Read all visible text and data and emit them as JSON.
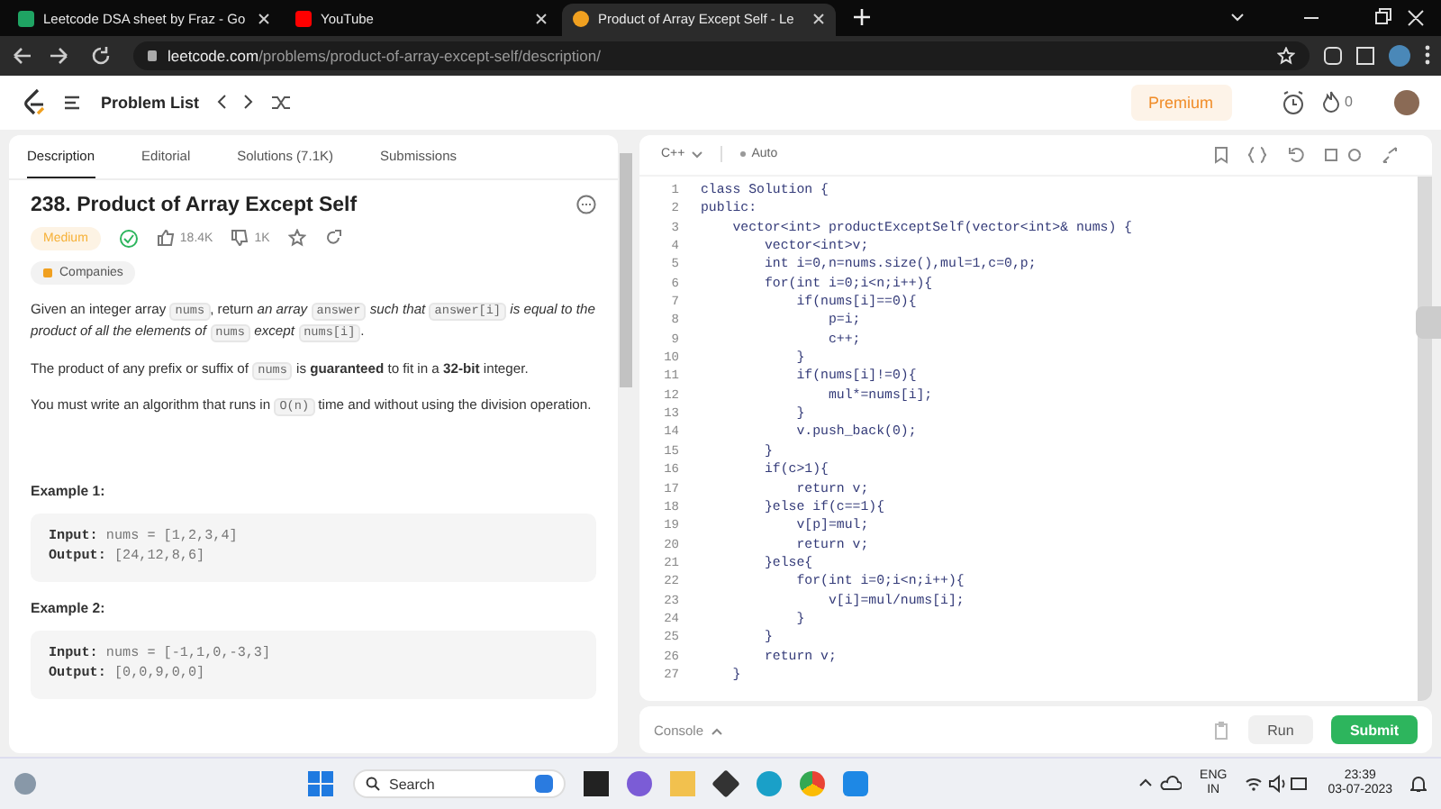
{
  "browser": {
    "tabs": [
      {
        "title": "Leetcode DSA sheet by Fraz - Go",
        "selected": false
      },
      {
        "title": "YouTube",
        "selected": false
      },
      {
        "title": "Product of Array Except Self - Le",
        "selected": true
      }
    ],
    "url_host": "leetcode.com",
    "url_path": "/problems/product-of-array-except-self/description/"
  },
  "header": {
    "problem_list": "Problem List",
    "premium": "Premium",
    "streak": "0"
  },
  "left_tabs": [
    {
      "label": "Description",
      "selected": true
    },
    {
      "label": "Editorial",
      "selected": false
    },
    {
      "label": "Solutions (7.1K)",
      "selected": false
    },
    {
      "label": "Submissions",
      "selected": false
    }
  ],
  "problem": {
    "title": "238. Product of Array Except Self",
    "difficulty": "Medium",
    "likes": "18.4K",
    "dislikes": "1K",
    "companies": "Companies",
    "paragraphs": [
      [
        {
          "kind": "text",
          "text": "Given an integer array "
        },
        {
          "kind": "code",
          "text": "nums"
        },
        {
          "kind": "text",
          "text": ", return *an array* "
        },
        {
          "kind": "code",
          "text": "answer"
        },
        {
          "kind": "text",
          "text": " *such that* "
        },
        {
          "kind": "code",
          "text": "answer[i]"
        },
        {
          "kind": "text",
          "text": " *is equal to the product of all the elements of* "
        },
        {
          "kind": "code",
          "text": "nums"
        },
        {
          "kind": "text",
          "text": " *except* "
        },
        {
          "kind": "code",
          "text": "nums[i]"
        },
        {
          "kind": "text",
          "text": "."
        }
      ],
      [
        {
          "kind": "text",
          "text": "The product of any prefix or suffix of "
        },
        {
          "kind": "code",
          "text": "nums"
        },
        {
          "kind": "text",
          "text": " is **guaranteed** to fit in a **32-bit** integer."
        }
      ],
      [
        {
          "kind": "text",
          "text": "You must write an algorithm that runs in "
        },
        {
          "kind": "code",
          "text": "O(n)"
        },
        {
          "kind": "text",
          "text": " time and without using the division operation."
        }
      ]
    ],
    "examples": [
      {
        "title": "Example 1:",
        "input_label": "Input:",
        "input": "nums = [1,2,3,4]",
        "output_label": "Output:",
        "output": "[24,12,8,6]"
      },
      {
        "title": "Example 2:",
        "input_label": "Input:",
        "input": "nums = [-1,1,0,-3,3]",
        "output_label": "Output:",
        "output": "[0,0,9,0,0]"
      }
    ]
  },
  "editor": {
    "language": "C++",
    "mode": "Auto",
    "lines": [
      {
        "n": "1",
        "code": "class Solution {"
      },
      {
        "n": "2",
        "code": "public:"
      },
      {
        "n": "3",
        "code": "    vector<int> productExceptSelf(vector<int>& nums) {"
      },
      {
        "n": "4",
        "code": "        vector<int>v;"
      },
      {
        "n": "5",
        "code": "        int i=0,n=nums.size(),mul=1,c=0,p;"
      },
      {
        "n": "6",
        "code": "        for(int i=0;i<n;i++){"
      },
      {
        "n": "7",
        "code": "            if(nums[i]==0){"
      },
      {
        "n": "8",
        "code": "                p=i;"
      },
      {
        "n": "9",
        "code": "                c++;"
      },
      {
        "n": "10",
        "code": "            }"
      },
      {
        "n": "11",
        "code": "            if(nums[i]!=0){"
      },
      {
        "n": "12",
        "code": "                mul*=nums[i];"
      },
      {
        "n": "13",
        "code": "            }"
      },
      {
        "n": "14",
        "code": "            v.push_back(0);"
      },
      {
        "n": "15",
        "code": "        }"
      },
      {
        "n": "16",
        "code": "        if(c>1){"
      },
      {
        "n": "17",
        "code": "            return v;"
      },
      {
        "n": "18",
        "code": "        }else if(c==1){"
      },
      {
        "n": "19",
        "code": "            v[p]=mul;"
      },
      {
        "n": "20",
        "code": "            return v;"
      },
      {
        "n": "21",
        "code": "        }else{"
      },
      {
        "n": "22",
        "code": "            for(int i=0;i<n;i++){"
      },
      {
        "n": "23",
        "code": "                v[i]=mul/nums[i];"
      },
      {
        "n": "24",
        "code": "            }"
      },
      {
        "n": "25",
        "code": "        }"
      },
      {
        "n": "26",
        "code": "        return v;"
      },
      {
        "n": "27",
        "code": "    }"
      }
    ]
  },
  "console": {
    "label": "Console",
    "run": "Run",
    "submit": "Submit"
  },
  "taskbar": {
    "search": "Search",
    "lang": "ENG",
    "region": "IN",
    "time": "23:39",
    "date": "03-07-2023"
  }
}
